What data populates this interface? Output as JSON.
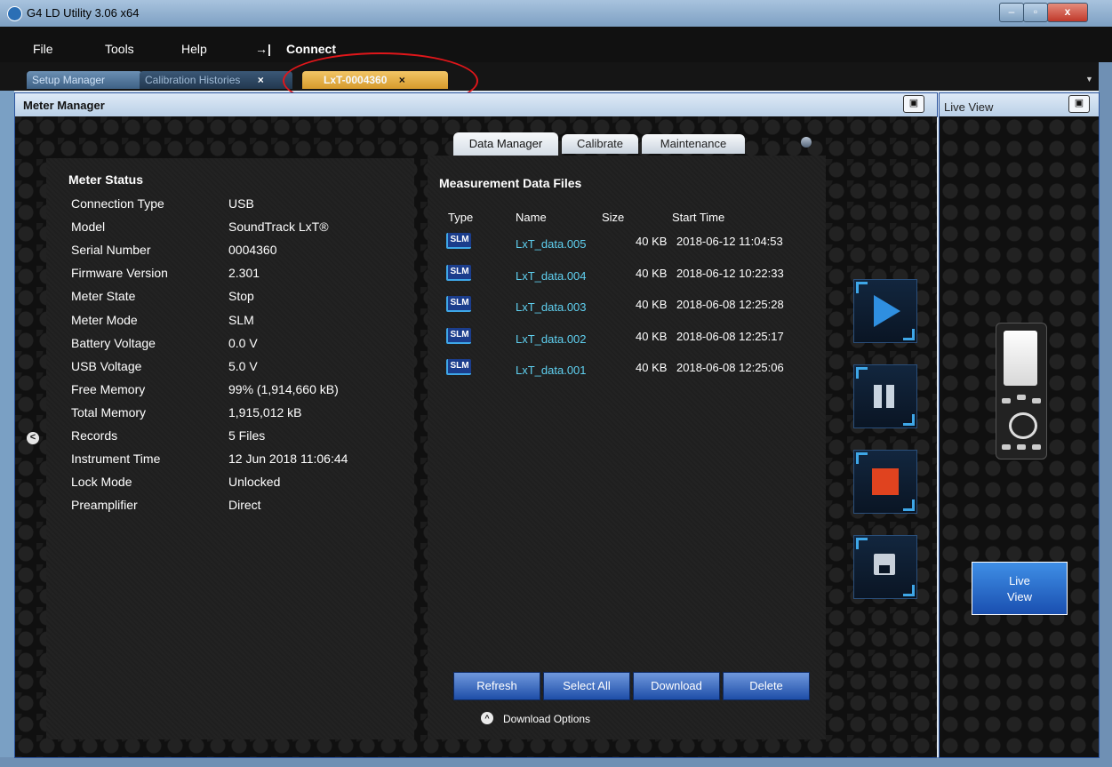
{
  "window": {
    "title": "G4 LD Utility 3.06 x64",
    "min": "–",
    "max": "▫",
    "close": "x"
  },
  "menu": {
    "file": "File",
    "tools": "Tools",
    "help": "Help",
    "connect_arrow": "→|",
    "connect": "Connect"
  },
  "doc_tabs": {
    "setup": "Setup Manager",
    "calibration": "Calibration Histories",
    "calibration_close": "×",
    "meter": "LxT-0004360",
    "meter_close": "×"
  },
  "panels": {
    "meter_manager": "Meter Manager",
    "live_view": "Live View",
    "dock": "▣"
  },
  "meter_status": {
    "title": "Meter Status",
    "rows": [
      {
        "label": "Connection Type",
        "value": "USB"
      },
      {
        "label": "Model",
        "value": "SoundTrack LxT®"
      },
      {
        "label": "Serial Number",
        "value": "0004360"
      },
      {
        "label": "Firmware Version",
        "value": "2.301"
      },
      {
        "label": "Meter State",
        "value": "Stop"
      },
      {
        "label": "Meter Mode",
        "value": "SLM"
      },
      {
        "label": "Battery Voltage",
        "value": "0.0 V"
      },
      {
        "label": "USB Voltage",
        "value": "5.0 V"
      },
      {
        "label": "Free Memory",
        "value": "99% (1,914,660 kB)"
      },
      {
        "label": "Total Memory",
        "value": "1,915,012 kB"
      },
      {
        "label": "Records",
        "value": "5 Files"
      },
      {
        "label": "Instrument Time",
        "value": "12 Jun 2018 11:06:44"
      },
      {
        "label": "Lock Mode",
        "value": "Unlocked"
      },
      {
        "label": "Preamplifier",
        "value": "Direct"
      }
    ]
  },
  "inner_tabs": {
    "data_manager": "Data Manager",
    "calibrate": "Calibrate",
    "maintenance": "Maintenance"
  },
  "data_files": {
    "title": "Measurement Data Files",
    "columns": {
      "type": "Type",
      "name": "Name",
      "size": "Size",
      "start": "Start Time"
    },
    "rows": [
      {
        "type": "SLM",
        "name": "LxT_data.005",
        "size": "40 KB",
        "start": "2018-06-12  11:04:53"
      },
      {
        "type": "SLM",
        "name": "LxT_data.004",
        "size": "40 KB",
        "start": "2018-06-12  10:22:33"
      },
      {
        "type": "SLM",
        "name": "LxT_data.003",
        "size": "40 KB",
        "start": "2018-06-08  12:25:28"
      },
      {
        "type": "SLM",
        "name": "LxT_data.002",
        "size": "40 KB",
        "start": "2018-06-08  12:25:17"
      },
      {
        "type": "SLM",
        "name": "LxT_data.001",
        "size": "40 KB",
        "start": "2018-06-08  12:25:06"
      }
    ]
  },
  "actions": {
    "refresh": "Refresh",
    "select_all": "Select All",
    "download": "Download",
    "delete": "Delete",
    "download_options": "Download Options",
    "download_options_icon": "^"
  },
  "collapse_icon": "<",
  "live_view_button": {
    "line1": "Live",
    "line2": "View"
  }
}
